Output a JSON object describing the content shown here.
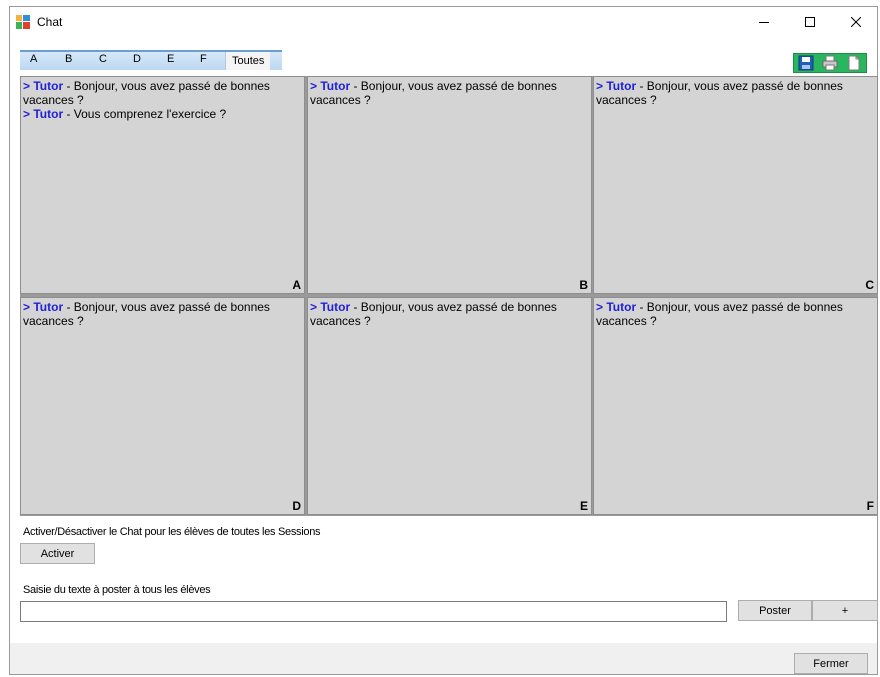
{
  "window": {
    "title": "Chat"
  },
  "window_controls": {
    "minimize": "—",
    "maximize": "☐",
    "close": "✕"
  },
  "tabs": [
    {
      "label": "A"
    },
    {
      "label": "B"
    },
    {
      "label": "C"
    },
    {
      "label": "D"
    },
    {
      "label": "E"
    },
    {
      "label": "F"
    },
    {
      "label": "Toutes",
      "active": true
    }
  ],
  "toolbar": {
    "icons": [
      "save-icon",
      "print-icon",
      "document-icon"
    ]
  },
  "panels": [
    {
      "label": "A",
      "messages": [
        {
          "author": "> Tutor",
          "text": " - Bonjour, vous avez passé de bonnes vacances ?"
        },
        {
          "author": "> Tutor",
          "text": " - Vous comprenez l'exercice ?"
        }
      ]
    },
    {
      "label": "B",
      "messages": [
        {
          "author": "> Tutor",
          "text": " - Bonjour, vous avez passé de bonnes vacances ?"
        }
      ]
    },
    {
      "label": "C",
      "messages": [
        {
          "author": "> Tutor",
          "text": " - Bonjour, vous avez passé de bonnes vacances ?"
        }
      ]
    },
    {
      "label": "D",
      "messages": [
        {
          "author": "> Tutor",
          "text": " - Bonjour, vous avez passé de bonnes vacances ?"
        }
      ]
    },
    {
      "label": "E",
      "messages": [
        {
          "author": "> Tutor",
          "text": " - Bonjour, vous avez passé de bonnes vacances ?"
        }
      ]
    },
    {
      "label": "F",
      "messages": [
        {
          "author": "> Tutor",
          "text": " - Bonjour, vous avez passé de bonnes vacances ?"
        }
      ]
    }
  ],
  "activation": {
    "label": "Activer/Désactiver le Chat pour les élèves de toutes les Sessions",
    "button": "Activer"
  },
  "post": {
    "label": "Saisie du texte à poster à tous les élèves",
    "value": "",
    "placeholder": "",
    "post_button": "Poster",
    "plus_button": "+"
  },
  "footer": {
    "close_button": "Fermer"
  },
  "colors": {
    "author": "#1f1fd6",
    "panel_bg": "#d4d4d4",
    "toolbar": "#2ab55f",
    "tab_strip": "#bcd8f2"
  }
}
